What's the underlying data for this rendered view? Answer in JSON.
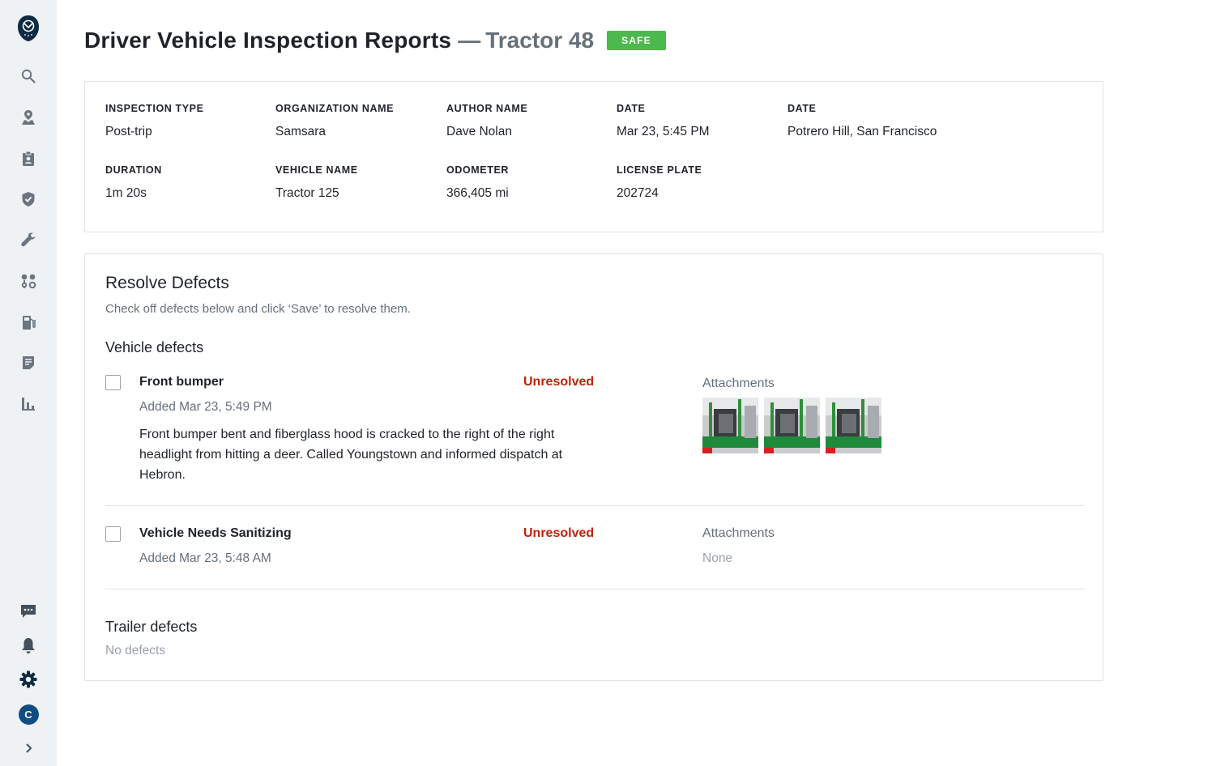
{
  "nav": {
    "avatar_letter": "C",
    "items": [
      "logo-icon",
      "search-icon",
      "map-pin-icon",
      "clipboard-user-icon",
      "shield-check-icon",
      "wrench-icon",
      "route-icon",
      "fuel-icon",
      "document-icon",
      "bar-chart-icon",
      "chat-icon",
      "bell-icon",
      "gear-icon",
      "avatar",
      "chevron-right-icon"
    ]
  },
  "header": {
    "title": "Driver Vehicle Inspection Reports",
    "dash": "—",
    "vehicle": "Tractor 48",
    "badge": "SAFE",
    "badge_color": "#4bb94d"
  },
  "info": {
    "inspection_type": {
      "label": "INSPECTION TYPE",
      "value": "Post-trip"
    },
    "organization": {
      "label": "ORGANIZATION NAME",
      "value": "Samsara"
    },
    "author": {
      "label": "AUTHOR NAME",
      "value": "Dave Nolan"
    },
    "date": {
      "label": "DATE",
      "value": "Mar 23, 5:45 PM"
    },
    "location": {
      "label": "DATE",
      "value": "Potrero Hill, San Francisco"
    },
    "duration": {
      "label": "DURATION",
      "value": "1m 20s"
    },
    "vehicle_name": {
      "label": "VEHICLE NAME",
      "value": "Tractor 125"
    },
    "odometer": {
      "label": "ODOMETER",
      "value": "366,405 mi"
    },
    "license_plate": {
      "label": "LICENSE PLATE",
      "value": "202724"
    }
  },
  "defects": {
    "title": "Resolve Defects",
    "description": "Check off defects below and click ‘Save’ to resolve them.",
    "vehicle_group": "Vehicle defects",
    "items": [
      {
        "name": "Front bumper",
        "status": "Unresolved",
        "added": "Added Mar 23, 5:49 PM",
        "description": "Front bumper bent and fiberglass hood is cracked to the right of the right headlight from hitting a deer. Called Youngstown and informed dispatch at Hebron.",
        "attachments_label": "Attachments"
      },
      {
        "name": "Vehicle Needs Sanitizing",
        "status": "Unresolved",
        "added": "Added Mar 23, 5:48 AM",
        "attachments_label": "Attachments",
        "attachments_none": "None"
      }
    ],
    "trailer_group": "Trailer defects",
    "trailer_none": "No defects",
    "status_color": "#c2210a"
  }
}
